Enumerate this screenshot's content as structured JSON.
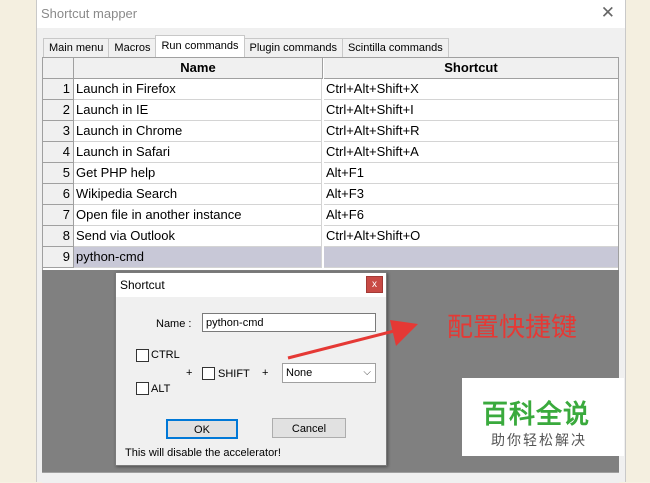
{
  "window": {
    "title": "Shortcut mapper",
    "close_glyph": "✕"
  },
  "tabs": [
    {
      "label": "Main menu",
      "active": false
    },
    {
      "label": "Macros",
      "active": false
    },
    {
      "label": "Run commands",
      "active": true
    },
    {
      "label": "Plugin commands",
      "active": false
    },
    {
      "label": "Scintilla commands",
      "active": false
    }
  ],
  "table": {
    "columns": [
      "Name",
      "Shortcut"
    ],
    "rows": [
      {
        "num": "1",
        "name": "Launch in Firefox",
        "shortcut": "Ctrl+Alt+Shift+X"
      },
      {
        "num": "2",
        "name": "Launch in IE",
        "shortcut": "Ctrl+Alt+Shift+I"
      },
      {
        "num": "3",
        "name": "Launch in Chrome",
        "shortcut": "Ctrl+Alt+Shift+R"
      },
      {
        "num": "4",
        "name": "Launch in Safari",
        "shortcut": "Ctrl+Alt+Shift+A"
      },
      {
        "num": "5",
        "name": "Get PHP help",
        "shortcut": "Alt+F1"
      },
      {
        "num": "6",
        "name": "Wikipedia Search",
        "shortcut": "Alt+F3"
      },
      {
        "num": "7",
        "name": "Open file in another instance",
        "shortcut": "Alt+F6"
      },
      {
        "num": "8",
        "name": "Send via Outlook",
        "shortcut": "Ctrl+Alt+Shift+O"
      },
      {
        "num": "9",
        "name": "python-cmd",
        "shortcut": ""
      }
    ],
    "selected_row": 9
  },
  "dialog": {
    "title": "Shortcut",
    "close_glyph": "x",
    "name_label": "Name :",
    "name_value": "python-cmd",
    "ctrl_label": "CTRL",
    "alt_label": "ALT",
    "shift_label": "SHIFT",
    "plus1": "+",
    "plus2": "+",
    "key_select": "None",
    "ok_label": "OK",
    "cancel_label": "Cancel",
    "note": "This will disable the accelerator!"
  },
  "annotation": {
    "text": "配置快捷键",
    "color": "#e53935"
  },
  "watermark": {
    "line1": "百科全说",
    "line2": "助你轻松解决"
  }
}
